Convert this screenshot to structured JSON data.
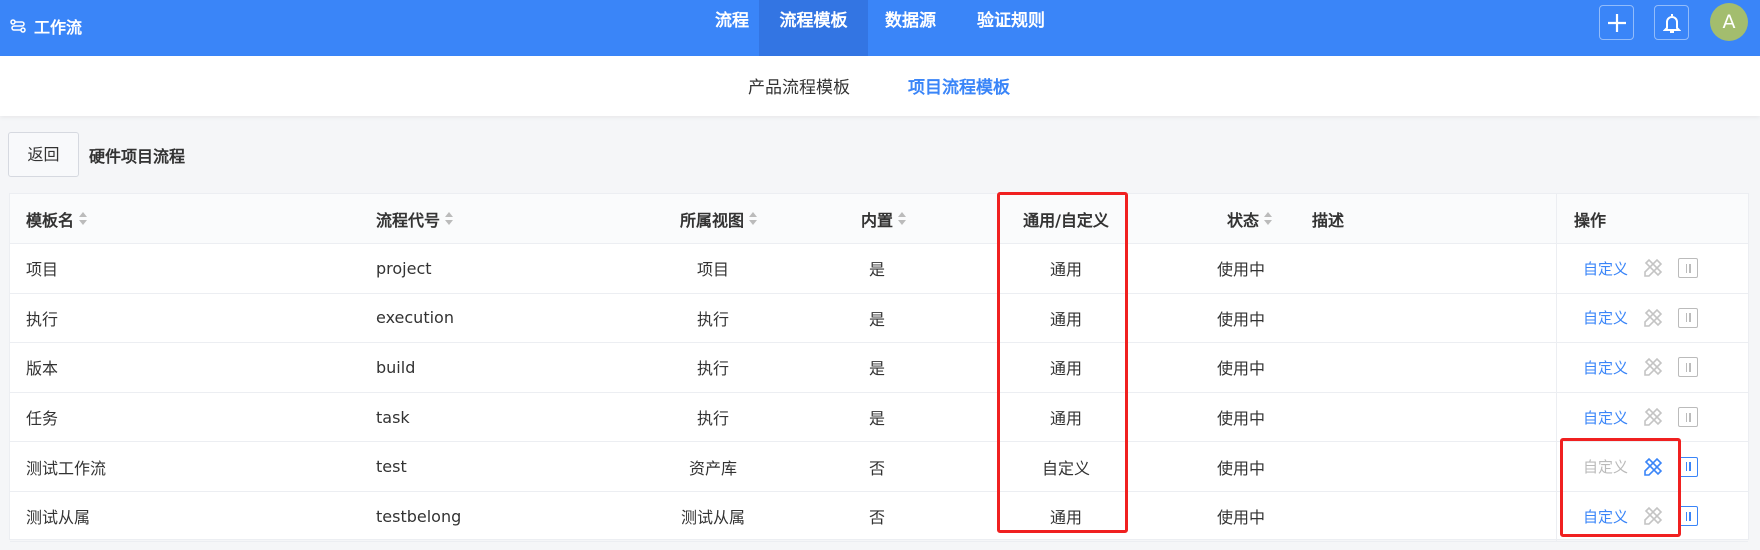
{
  "app": {
    "title": "工作流",
    "avatar_letter": "A"
  },
  "nav": [
    {
      "label": "流程",
      "active": false
    },
    {
      "label": "流程模板",
      "active": true
    },
    {
      "label": "数据源",
      "active": false
    },
    {
      "label": "验证规则",
      "active": false
    }
  ],
  "subnav": [
    {
      "label": "产品流程模板",
      "active": false
    },
    {
      "label": "项目流程模板",
      "active": true
    }
  ],
  "page": {
    "back_label": "返回",
    "title": "硬件项目流程"
  },
  "table": {
    "headers": [
      "模板名",
      "流程代号",
      "所属视图",
      "内置",
      "通用/自定义",
      "状态",
      "描述",
      "操作"
    ],
    "rows": [
      {
        "name": "项目",
        "code": "project",
        "view": "项目",
        "builtin": "是",
        "type": "通用",
        "status": "使用中",
        "desc": "",
        "action": "自定义",
        "action_enabled": true,
        "design_active": false,
        "pause_active": false
      },
      {
        "name": "执行",
        "code": "execution",
        "view": "执行",
        "builtin": "是",
        "type": "通用",
        "status": "使用中",
        "desc": "",
        "action": "自定义",
        "action_enabled": true,
        "design_active": false,
        "pause_active": false
      },
      {
        "name": "版本",
        "code": "build",
        "view": "执行",
        "builtin": "是",
        "type": "通用",
        "status": "使用中",
        "desc": "",
        "action": "自定义",
        "action_enabled": true,
        "design_active": false,
        "pause_active": false
      },
      {
        "name": "任务",
        "code": "task",
        "view": "执行",
        "builtin": "是",
        "type": "通用",
        "status": "使用中",
        "desc": "",
        "action": "自定义",
        "action_enabled": true,
        "design_active": false,
        "pause_active": false
      },
      {
        "name": "测试工作流",
        "code": "test",
        "view": "资产库",
        "builtin": "否",
        "type": "自定义",
        "status": "使用中",
        "desc": "",
        "action": "自定义",
        "action_enabled": false,
        "design_active": true,
        "pause_active": true
      },
      {
        "name": "测试从属",
        "code": "testbelong",
        "view": "测试从属",
        "builtin": "否",
        "type": "通用",
        "status": "使用中",
        "desc": "",
        "action": "自定义",
        "action_enabled": true,
        "design_active": false,
        "pause_active": true
      }
    ]
  },
  "colors": {
    "brand": "#3a85f8",
    "highlight": "#f02020"
  }
}
